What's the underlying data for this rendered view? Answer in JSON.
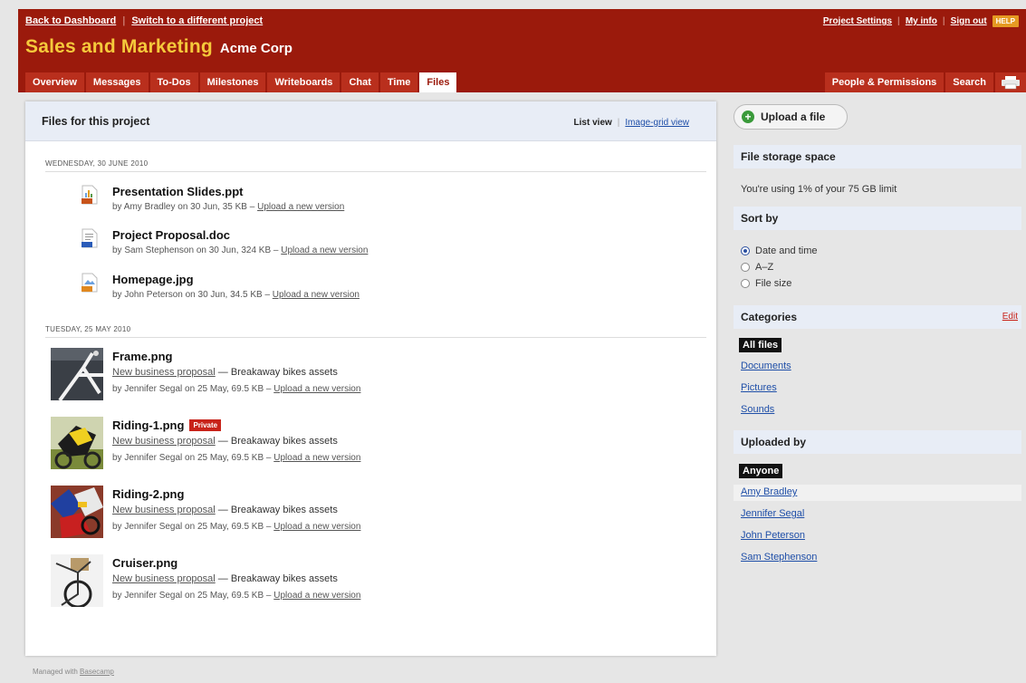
{
  "header": {
    "back_link": "Back to Dashboard",
    "switch_link": "Switch to a different project",
    "project_settings": "Project Settings",
    "my_info": "My info",
    "sign_out": "Sign out",
    "help": "HELP",
    "project_name": "Sales and Marketing",
    "company_name": "Acme Corp"
  },
  "tabs": [
    {
      "label": "Overview"
    },
    {
      "label": "Messages"
    },
    {
      "label": "To-Dos"
    },
    {
      "label": "Milestones"
    },
    {
      "label": "Writeboards"
    },
    {
      "label": "Chat"
    },
    {
      "label": "Time"
    },
    {
      "label": "Files"
    }
  ],
  "tabs_right": {
    "people": "People & Permissions",
    "search": "Search"
  },
  "main": {
    "title": "Files for this project",
    "list_view": "List view",
    "grid_view": "Image-grid view",
    "groups": [
      {
        "date": "WEDNESDAY, 30 JUNE 2010",
        "files": [
          {
            "name": "Presentation Slides.ppt",
            "meta": "by Amy Bradley on 30 Jun, 35 KB –",
            "upload": "Upload a new version",
            "icon": "ppt-icon",
            "icon_color": "#c8531a"
          },
          {
            "name": "Project Proposal.doc",
            "meta": "by Sam Stephenson on 30 Jun, 324 KB –",
            "upload": "Upload a new version",
            "icon": "doc-icon",
            "icon_color": "#2a5cb8"
          },
          {
            "name": "Homepage.jpg",
            "meta": "by John Peterson on 30 Jun, 34.5 KB –",
            "upload": "Upload a new version",
            "icon": "jpg-icon",
            "icon_color": "#e0881f"
          }
        ]
      },
      {
        "date": "TUESDAY, 25 MAY 2010",
        "files": [
          {
            "name": "Frame.png",
            "project": "New business proposal",
            "list": "— Breakaway bikes assets",
            "meta": "by Jennifer Segal on 25 May, 69.5 KB –",
            "upload": "Upload a new version"
          },
          {
            "name": "Riding-1.png",
            "badge": "Private",
            "project": "New business proposal",
            "list": "— Breakaway bikes assets",
            "meta": "by Jennifer Segal on 25 May, 69.5 KB –",
            "upload": "Upload a new version"
          },
          {
            "name": "Riding-2.png",
            "project": "New business proposal",
            "list": "— Breakaway bikes assets",
            "meta": "by Jennifer Segal on 25 May, 69.5 KB –",
            "upload": "Upload a new version"
          },
          {
            "name": "Cruiser.png",
            "project": "New business proposal",
            "list": "— Breakaway bikes assets",
            "meta": "by Jennifer Segal on 25 May, 69.5 KB –",
            "upload": "Upload a new version"
          }
        ]
      }
    ]
  },
  "sidebar": {
    "upload_button": "Upload a file",
    "storage_title": "File storage space",
    "storage_text": "You're using 1% of your 75 GB limit",
    "sort_title": "Sort by",
    "sort_options": [
      "Date and time",
      "A–Z",
      "File size"
    ],
    "categories_title": "Categories",
    "categories_edit": "Edit",
    "categories": [
      "All files",
      "Documents",
      "Pictures",
      "Sounds"
    ],
    "uploaded_title": "Uploaded by",
    "uploaders": [
      "Anyone",
      "Amy Bradley",
      "Jennifer Segal",
      "John Peterson",
      "Sam Stephenson"
    ]
  },
  "footer": {
    "managed": "Managed with",
    "product": "Basecamp"
  }
}
